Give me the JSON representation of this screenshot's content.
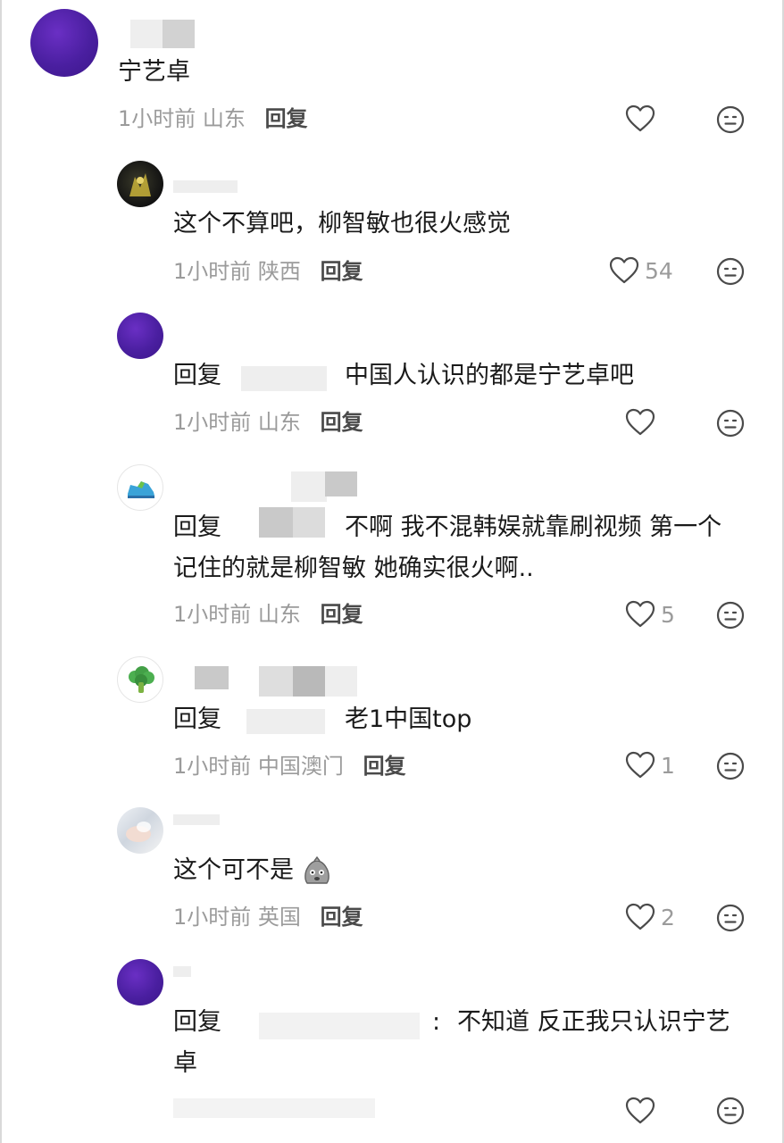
{
  "comments": [
    {
      "text": "宁艺卓",
      "time": "1小时前",
      "location": "山东",
      "reply": "回复",
      "likes": ""
    },
    {
      "text": "这个不算吧，柳智敏也很火感觉",
      "time": "1小时前",
      "location": "陕西",
      "reply": "回复",
      "likes": "54"
    },
    {
      "prefix": "回复",
      "text": "中国人认识的都是宁艺卓吧",
      "time": "1小时前",
      "location": "山东",
      "reply": "回复",
      "likes": ""
    },
    {
      "prefix": "回复",
      "text": "不啊 我不混韩娱就靠刷视频 第一个",
      "text2": "记住的就是柳智敏 她确实很火啊..",
      "time": "1小时前",
      "location": "山东",
      "reply": "回复",
      "likes": "5"
    },
    {
      "prefix": "回复",
      "text": "老1中国top",
      "time": "1小时前",
      "location": "中国澳门",
      "reply": "回复",
      "likes": "1"
    },
    {
      "text": "这个可不是",
      "time": "1小时前",
      "location": "英国",
      "reply": "回复",
      "likes": "2"
    },
    {
      "prefix": "回复",
      "colon": ":",
      "text": "不知道 反正我只认识宁艺",
      "text2": "卓",
      "likes": ""
    }
  ],
  "icons": {
    "like": "heart-outline-icon",
    "dislike": "neutral-face-icon"
  },
  "colors": {
    "meta": "#9b9b9b",
    "text": "#1a1a1a",
    "reply": "#4a4a4a",
    "avatar_purple": "#4a1fa0"
  }
}
